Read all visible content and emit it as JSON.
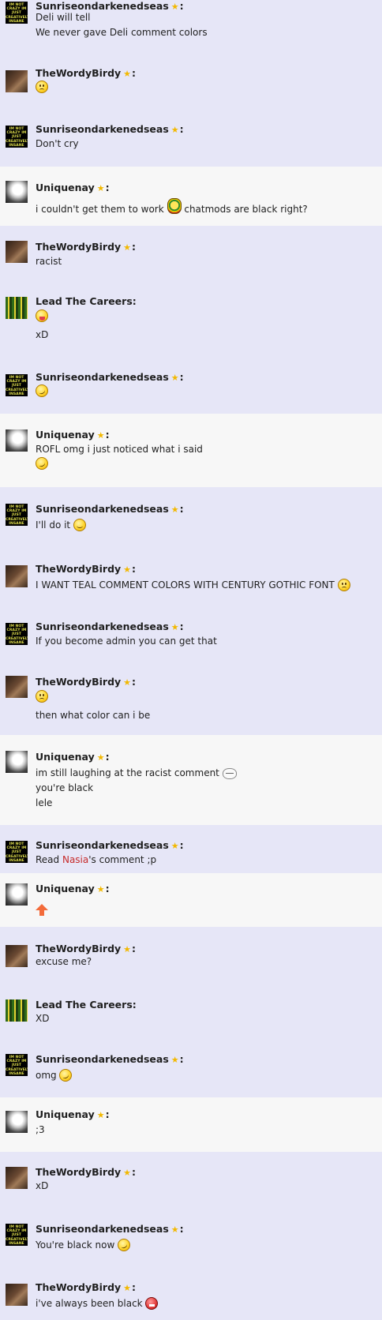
{
  "users": {
    "sunrise": "Sunriseondarkenedseas",
    "wordy": "TheWordyBirdy",
    "uni": "Uniquenay",
    "lead": "Lead The Careers:"
  },
  "avatar_text": "IM NOT CRAZY IM JUST CREATIVELY INSANE",
  "star": "★",
  "colon": ":",
  "messages": [
    {
      "lines": [
        "Deli will tell",
        "We never gave Deli comment colors"
      ]
    },
    {
      "lines": []
    },
    {
      "lines": [
        "Don't cry"
      ]
    },
    {
      "lines": [
        "i couldn't get them to work",
        "chatmods are black right?"
      ]
    },
    {
      "lines": [
        "racist"
      ]
    },
    {
      "lines": [
        "xD"
      ]
    },
    {
      "lines": []
    },
    {
      "lines": [
        "ROFL omg i just noticed what i said"
      ]
    },
    {
      "lines": [
        "I'll do it"
      ]
    },
    {
      "lines": [
        "I WANT TEAL COMMENT COLORS WITH CENTURY GOTHIC FONT"
      ]
    },
    {
      "lines": [
        "If you become admin you can get that"
      ]
    },
    {
      "lines": [
        "then what color can i be"
      ]
    },
    {
      "lines": [
        "im still laughing at the racist comment",
        "you're black",
        "lele"
      ]
    },
    {
      "lines": [
        "Read ",
        "Nasia",
        "'s comment ;p"
      ]
    },
    {
      "lines": []
    },
    {
      "lines": [
        "excuse me?"
      ]
    },
    {
      "lines": [
        "XD"
      ]
    },
    {
      "lines": [
        "omg"
      ]
    },
    {
      "lines": [
        ";3"
      ]
    },
    {
      "lines": [
        "xD"
      ]
    },
    {
      "lines": [
        "You're black now"
      ]
    },
    {
      "lines": [
        "i've always been black"
      ]
    }
  ],
  "colors": {
    "lavender": "#e6e6f7",
    "white_row": "#f7f7f7",
    "star": "#f2b800",
    "mention": "#c62a2a",
    "arrow": "#f36b3a"
  }
}
